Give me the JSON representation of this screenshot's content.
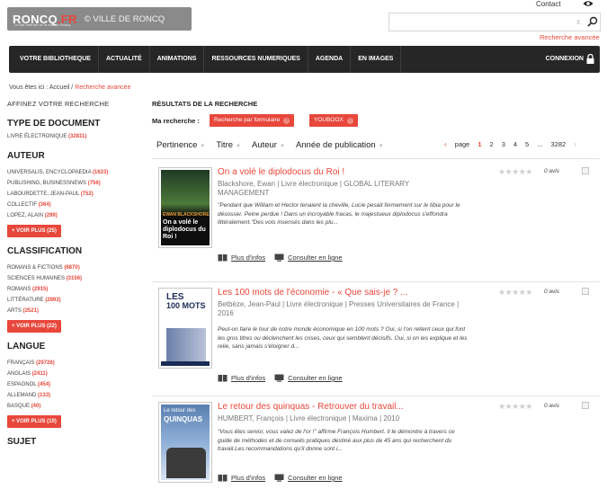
{
  "header": {
    "brand": "RONCQ",
    "brand_suffix": ".FR",
    "tagline": "Le site internet de la ville de Roncq",
    "copyright": "© VILLE DE RONCQ",
    "contact": "Contact",
    "search_value": "",
    "search_clear": "x",
    "advanced_search": "Recherche avancée"
  },
  "nav": {
    "items": [
      "VOTRE BIBLIOTHEQUE",
      "ACTUALITÉ",
      "ANIMATIONS",
      "RESSOURCES NUMERIQUES",
      "AGENDA",
      "EN IMAGES"
    ],
    "connexion": "CONNEXION"
  },
  "breadcrumb": {
    "prefix": "Vous êtes ici :",
    "home": "Accueil",
    "sep": "/",
    "current": "Recherche avancée"
  },
  "sidebar": {
    "title": "AFFINEZ VOTRE RECHERCHE",
    "facets": [
      {
        "heading": "TYPE DE DOCUMENT",
        "items": [
          {
            "label": "LIVRE ÉLECTRONIQUE",
            "count": "(32811)"
          }
        ],
        "more": ""
      },
      {
        "heading": "AUTEUR",
        "items": [
          {
            "label": "UNIVERSALIS, ENCYCLOPAEDIA",
            "count": "(1623)"
          },
          {
            "label": "PUBLISHING, BUSINESSNEWS",
            "count": "(756)"
          },
          {
            "label": "LABOURDETTE, JEAN-PAUL",
            "count": "(752)"
          },
          {
            "label": "COLLECTIF",
            "count": "(364)"
          },
          {
            "label": "LOPEZ, ALAIN",
            "count": "(299)"
          }
        ],
        "more": "+ VOIR PLUS (25)"
      },
      {
        "heading": "CLASSIFICATION",
        "items": [
          {
            "label": "ROMANS & FICTIONS",
            "count": "(6870)"
          },
          {
            "label": "SCIENCES HUMAINES",
            "count": "(3156)"
          },
          {
            "label": "ROMANS",
            "count": "(2915)"
          },
          {
            "label": "LITTÉRATURE",
            "count": "(2893)"
          },
          {
            "label": "ARTS",
            "count": "(2521)"
          }
        ],
        "more": "+ VOIR PLUS (22)"
      },
      {
        "heading": "LANGUE",
        "items": [
          {
            "label": "FRANÇAIS",
            "count": "(29726)"
          },
          {
            "label": "ANGLAIS",
            "count": "(2411)"
          },
          {
            "label": "ESPAGNOL",
            "count": "(454)"
          },
          {
            "label": "ALLEMAND",
            "count": "(133)"
          },
          {
            "label": "BASQUE",
            "count": "(40)"
          }
        ],
        "more": "+ VOIR PLUS (10)"
      },
      {
        "heading": "SUJET",
        "items": [],
        "more": ""
      }
    ]
  },
  "results": {
    "title": "RÉSULTATS DE LA RECHERCHE",
    "my_search_label": "Ma recherche :",
    "chips": [
      "Recherche par formulaire",
      "YOUBOOX"
    ],
    "sort": [
      "Pertinence",
      "Titre",
      "Auteur",
      "Année de publication"
    ],
    "pager": {
      "label": "page",
      "pages": [
        "1",
        "2",
        "3",
        "4",
        "5"
      ],
      "ellipsis": "...",
      "last": "3282",
      "prev": "‹",
      "next": "›"
    },
    "items": [
      {
        "title": "On a volé le diplodocus du Roi !",
        "meta": "Blackshore, Ewan | Livre électronique | GLOBAL LITERARY MANAGEMENT",
        "desc": "\"Pendant que William et Hector tenaient la cheville, Lucie pesait fermement sur le tibia pour le désosser. Peine perdue ! Dans un incroyable fracas, le majestueux diplodocus s'effondra littéralement.\"Des vols insensés dans les plu...",
        "avis": "0 avis",
        "more_info": "Plus d'infos",
        "online": "Consulter en ligne",
        "cover_author": "EWAN BLACKSHORE",
        "cover_title": "On a volé le diplodocus du Roi !"
      },
      {
        "title": "Les 100 mots de l'économie - « Que sais-je ? ...",
        "meta": "Betbèze, Jean-Paul | Livre électronique | Presses Universitaires de France | 2016",
        "desc": "Peut-on faire le tour de notre monde économique en 100 mots ? Oui, si l'on retient ceux qui font les gros titres ou déclenchent les crises, ceux qui semblent décisifs. Oui, si on les explique et les relie, sans jamais s'éloigner d...",
        "avis": "0 avis",
        "more_info": "Plus d'infos",
        "online": "Consulter en ligne",
        "cover_author": "LES",
        "cover_title": "100 MOTS"
      },
      {
        "title": "Le retour des quinquas - Retrouver du travail...",
        "meta": "HUMBERT, François | Livre électronique | Maxima | 2010",
        "desc": "\"Vous êtes senior, vous valez de l'or !\" affirme François Humbert. Il le démontre à travers ce guide de méthodes et de conseils pratiques destiné aux plus de 45 ans qui recherchent du travail.Les recommandations qu'il donne sont i...",
        "avis": "0 avis",
        "more_info": "Plus d'infos",
        "online": "Consulter en ligne",
        "cover_author": "Le retour des",
        "cover_title": "QUINQUAS"
      }
    ]
  },
  "colors": {
    "accent": "#e8473b",
    "navbar": "#262626"
  }
}
